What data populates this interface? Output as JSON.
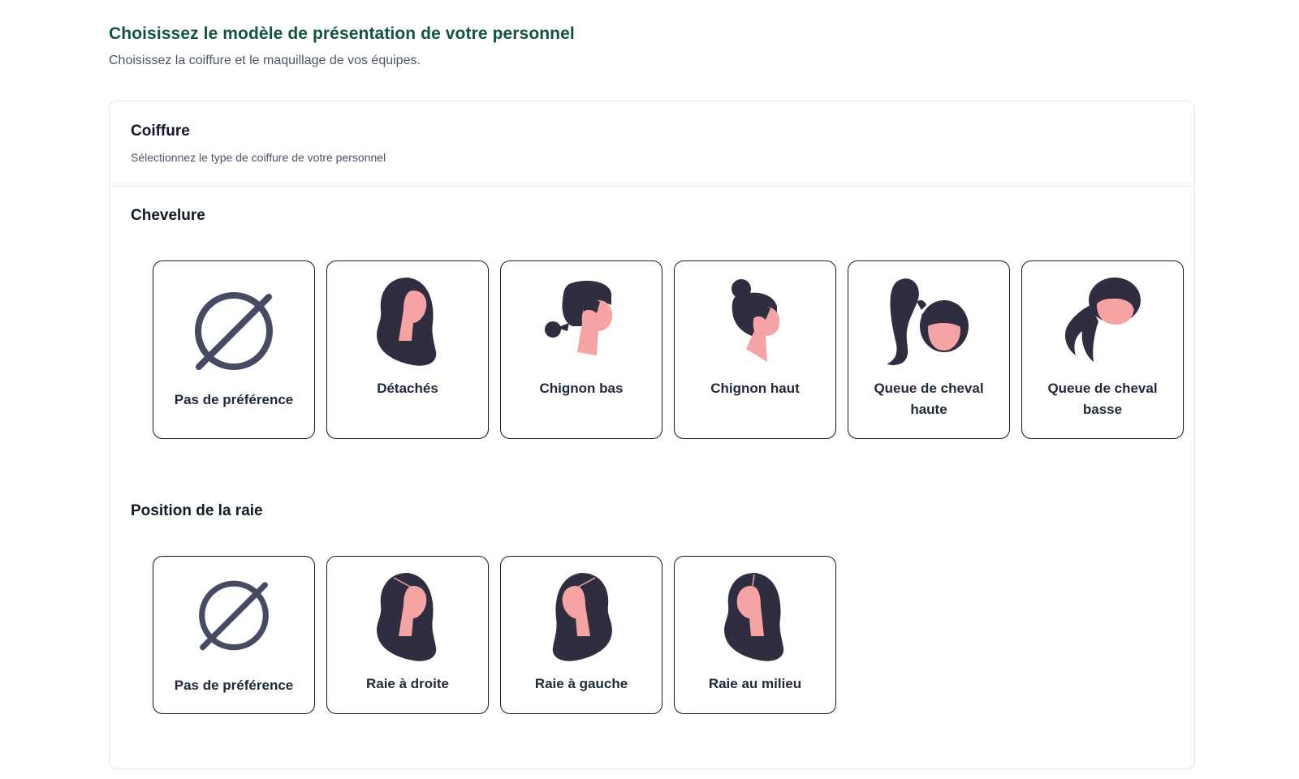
{
  "header": {
    "title": "Choisissez le modèle de présentation de votre personnel",
    "subtitle": "Choisissez la coiffure et le maquillage de vos équipes."
  },
  "coiffure": {
    "title": "Coiffure",
    "description": "Sélectionnez le type de coiffure de votre personnel"
  },
  "chevelure": {
    "title": "Chevelure",
    "options": [
      {
        "label": "Pas de préférence",
        "icon": "no-preference-icon"
      },
      {
        "label": "Détachés",
        "icon": "hair-loose-icon"
      },
      {
        "label": "Chignon bas",
        "icon": "low-bun-icon"
      },
      {
        "label": "Chignon haut",
        "icon": "high-bun-icon"
      },
      {
        "label": "Queue de cheval haute",
        "icon": "high-ponytail-icon"
      },
      {
        "label": "Queue de cheval basse",
        "icon": "low-ponytail-icon"
      }
    ]
  },
  "raie": {
    "title": "Position de la raie",
    "options": [
      {
        "label": "Pas de préférence",
        "icon": "no-preference-icon"
      },
      {
        "label": "Raie à droite",
        "icon": "part-right-icon"
      },
      {
        "label": "Raie à gauche",
        "icon": "part-left-icon"
      },
      {
        "label": "Raie au milieu",
        "icon": "part-middle-icon"
      }
    ]
  },
  "colors": {
    "title": "#125343",
    "hair": "#2f2e41",
    "skin": "#f5a3a3",
    "icon_stroke": "#474a63",
    "border": "#111827"
  }
}
